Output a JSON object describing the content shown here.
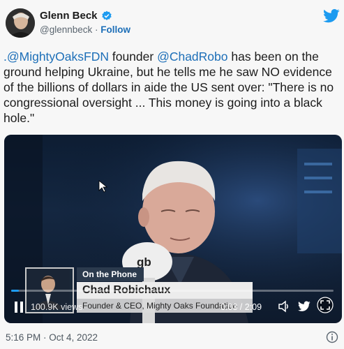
{
  "header": {
    "display_name": "Glenn Beck",
    "handle": "@glennbeck",
    "separator": "·",
    "follow_label": "Follow",
    "verified_color": "#1d9bf0"
  },
  "tweet": {
    "mention_1": ".@MightyOaksFDN",
    "text_1": " founder ",
    "mention_2": "@ChadRobo",
    "text_2": " has been on the ground helping Ukraine, but he tells me he saw NO evidence of the billions of dollars in aide the US sent over: \"There is no congressional oversight ... This money is going into a black hole.\""
  },
  "video": {
    "lower_third_label": "On the Phone",
    "lower_third_name": "Chad Robichaux",
    "lower_third_title": "Founder & CEO, Mighty Oaks Foundation",
    "mic_logo": "gb",
    "views": "100.9K views",
    "time": "0:03 / 2:09",
    "progress_fraction": 0.023
  },
  "footer": {
    "timestamp": "5:16 PM · Oct 4, 2022"
  },
  "icons": {
    "twitter_bird": "twitter-bird-icon",
    "info": "info-icon",
    "pause": "pause-icon",
    "volume": "volume-icon",
    "expand": "expand-icon"
  },
  "colors": {
    "accent": "#1d9bf0",
    "link": "#1d6fb8"
  }
}
